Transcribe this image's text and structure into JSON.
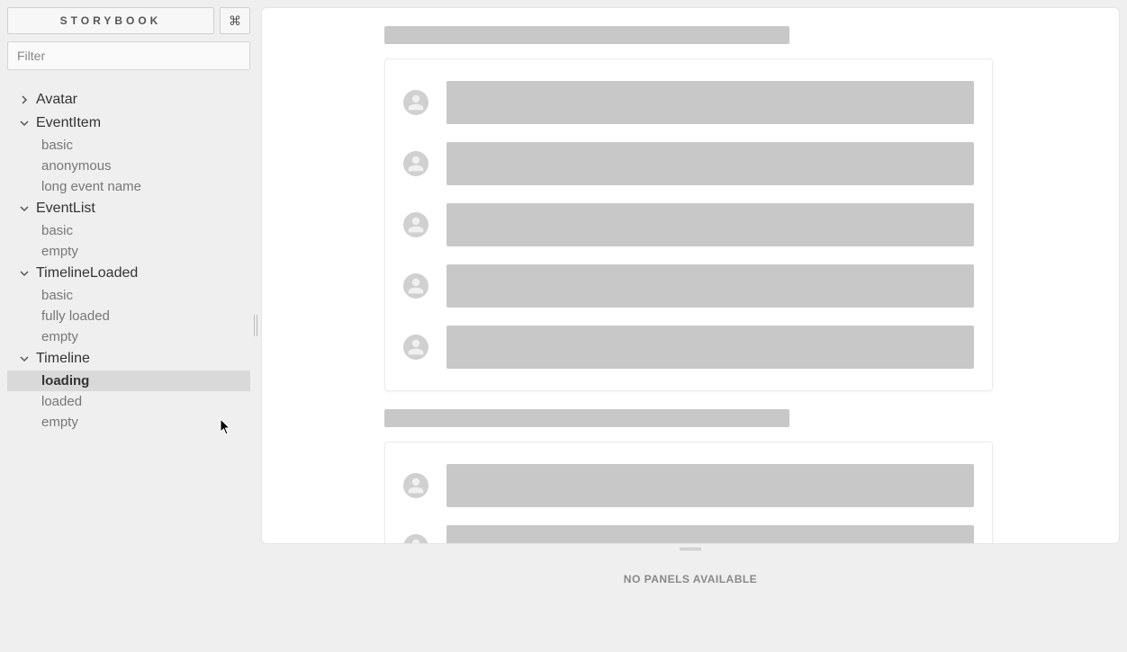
{
  "header": {
    "logo": "STORYBOOK",
    "shortcut": "⌘"
  },
  "filter": {
    "placeholder": "Filter"
  },
  "tree": [
    {
      "name": "Avatar",
      "expanded": false,
      "stories": []
    },
    {
      "name": "EventItem",
      "expanded": true,
      "stories": [
        {
          "name": "basic",
          "active": false
        },
        {
          "name": "anonymous",
          "active": false
        },
        {
          "name": "long event name",
          "active": false
        }
      ]
    },
    {
      "name": "EventList",
      "expanded": true,
      "stories": [
        {
          "name": "basic",
          "active": false
        },
        {
          "name": "empty",
          "active": false
        }
      ]
    },
    {
      "name": "TimelineLoaded",
      "expanded": true,
      "stories": [
        {
          "name": "basic",
          "active": false
        },
        {
          "name": "fully loaded",
          "active": false
        },
        {
          "name": "empty",
          "active": false
        }
      ]
    },
    {
      "name": "Timeline",
      "expanded": true,
      "stories": [
        {
          "name": "loading",
          "active": true
        },
        {
          "name": "loaded",
          "active": false
        },
        {
          "name": "empty",
          "active": false
        }
      ]
    }
  ],
  "preview": {
    "sections": [
      {
        "rows": 5
      },
      {
        "rows": 2
      }
    ]
  },
  "panel_message": "NO PANELS AVAILABLE"
}
